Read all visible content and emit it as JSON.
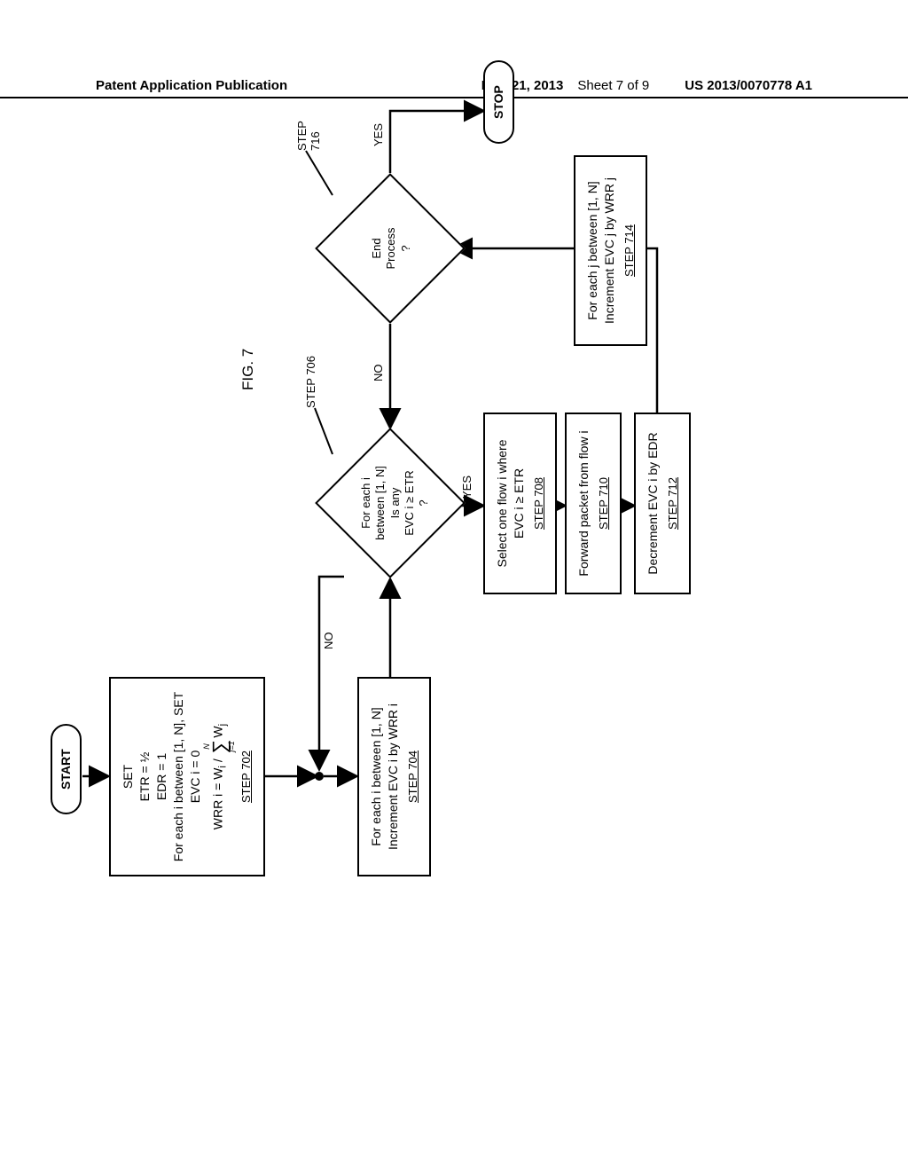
{
  "header": {
    "left": "Patent Application Publication",
    "date": "Mar. 21, 2013",
    "sheet": "Sheet 7 of 9",
    "pubno": "US 2013/0070778 A1"
  },
  "figure_label": "FIG. 7",
  "terminators": {
    "start": "START",
    "stop": "STOP"
  },
  "step702": {
    "l1": "SET",
    "l2": "ETR = ½",
    "l3": "EDR = 1",
    "l4": "For each i between [1, N], SET",
    "l5": "EVC i = 0",
    "l6_pre": "WRR i  =  W",
    "l6_sub_i": "i",
    "l6_slash": " / ",
    "sum_top": "N",
    "sum_bot": "j=1",
    "l6_post": "W",
    "l6_sub_j": "j",
    "step": "STEP 702"
  },
  "step704": {
    "l1": "For each i between [1, N]",
    "l2": "Increment EVC i by WRR i",
    "step": "STEP 704"
  },
  "step706": {
    "l1": "For each i",
    "l2": "between [1, N]",
    "l3": "Is any",
    "l4": "EVC i ≥ ETR",
    "l5": "?",
    "step_ptr": "STEP 706"
  },
  "step708": {
    "l1": "Select one flow i where",
    "l2": "EVC i ≥ ETR",
    "step": "STEP 708"
  },
  "step710": {
    "l1": "Forward packet from flow  i",
    "step": "STEP 710"
  },
  "step712": {
    "l1": "Decrement EVC i by EDR",
    "step": "STEP 712"
  },
  "step714": {
    "l1": "For each j between [1, N]",
    "l2": "Increment EVC j by WRR j",
    "step": "STEP 714"
  },
  "step716": {
    "l1": "End",
    "l2": "Process",
    "l3": "?",
    "step_ptr": "STEP 716"
  },
  "labels": {
    "yes": "YES",
    "no": "NO"
  }
}
